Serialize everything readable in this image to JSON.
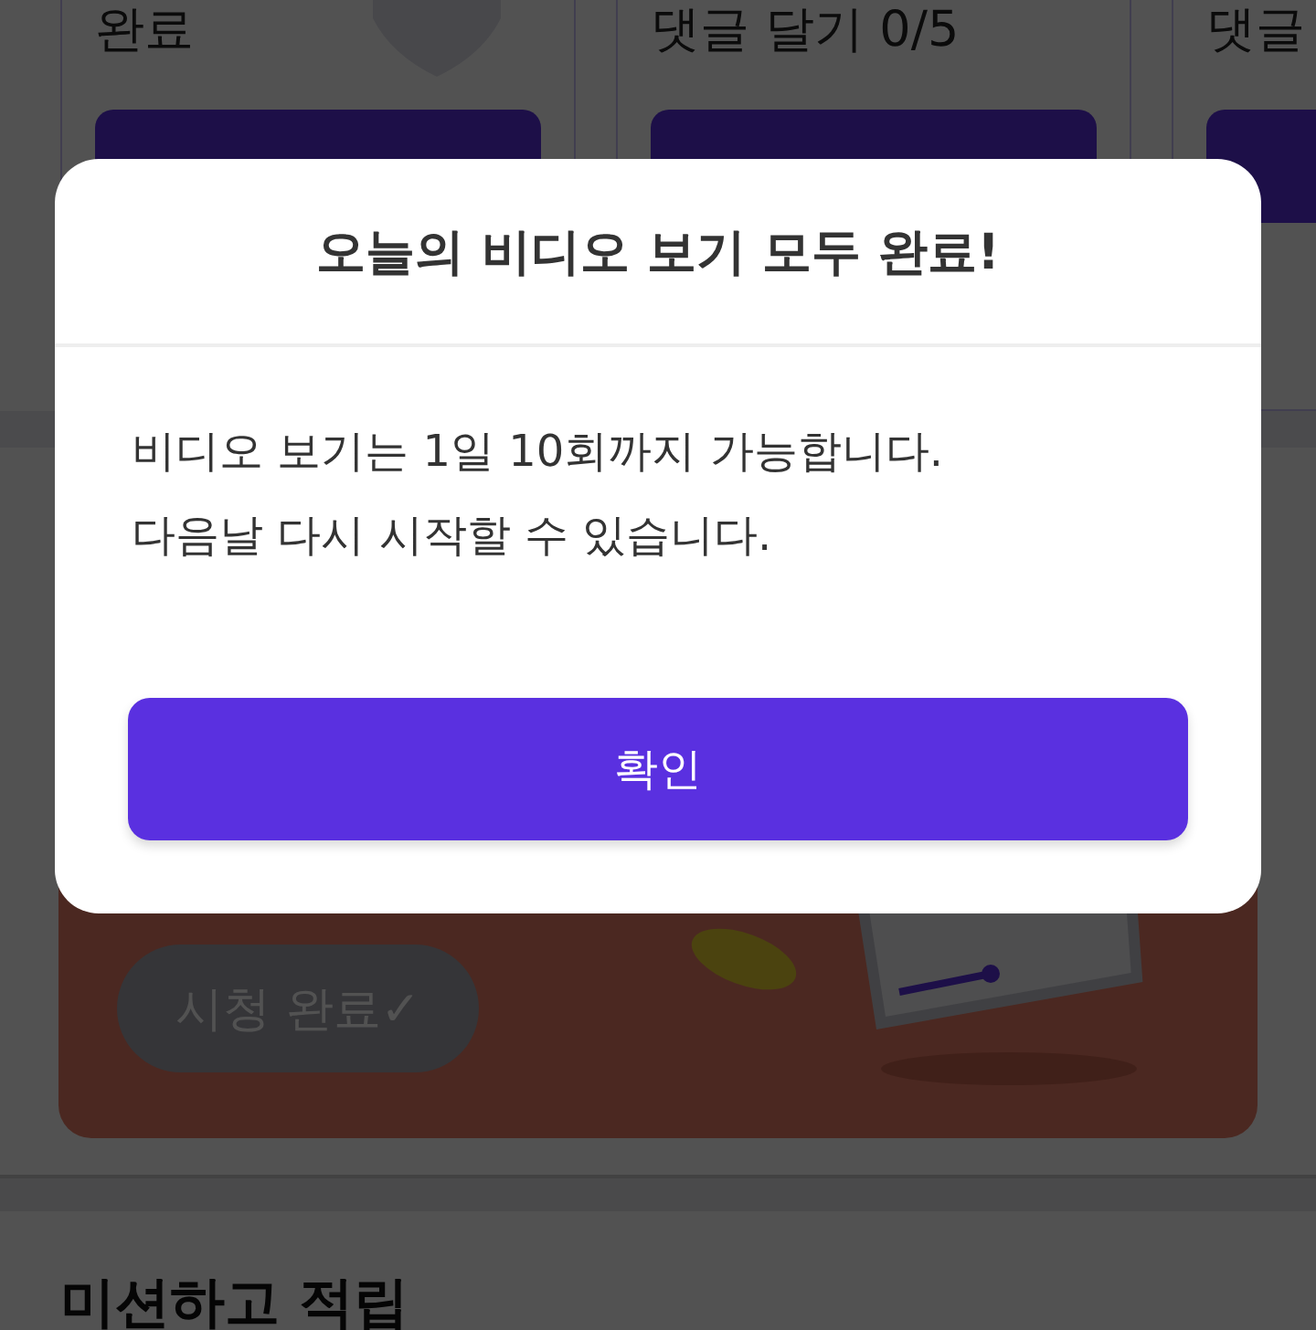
{
  "background": {
    "mission_cards": [
      {
        "title": "완료"
      },
      {
        "title": "댓글 달기 0/5"
      },
      {
        "title": "댓글"
      }
    ],
    "banner": {
      "status_button": "시청 완료✓"
    },
    "section_title": "미션하고 적립"
  },
  "dialog": {
    "title": "오늘의 비디오 보기 모두 완료!",
    "message_lines": [
      "비디오 보기는 1일 10회까지 가능합니다.",
      "다음날 다시 시작할 수 있습니다."
    ],
    "confirm_button": "확인"
  }
}
